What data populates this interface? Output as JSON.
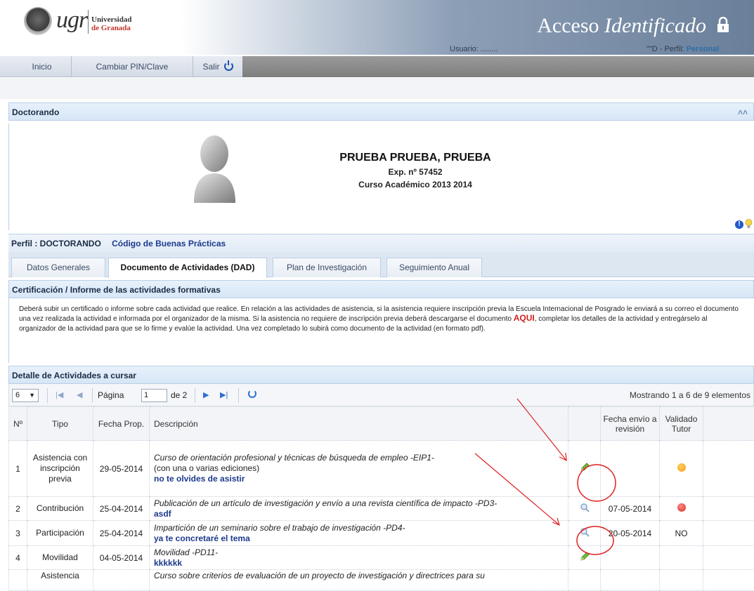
{
  "header": {
    "logo_text": "ugr",
    "university_line1": "Universidad",
    "university_line2": "de Granada",
    "title_plain": "Acceso ",
    "title_italic": "Identificado",
    "user_label": "Usuario: ........",
    "perfil_prefix": "\"\"D - Perfil:",
    "perfil_value": "Personal"
  },
  "nav": {
    "inicio": "Inicio",
    "cambiar_pin": "Cambiar PIN/Clave",
    "salir": "Salir"
  },
  "doctorando": {
    "section_title": "Doctorando",
    "name": "PRUEBA PRUEBA, PRUEBA",
    "expediente": "Exp. nº 57452",
    "curso": "Curso Académico 2013 2014"
  },
  "perfil_bar": {
    "perfil": "Perfil : DOCTORANDO",
    "codigo": "Código de Buenas Prácticas"
  },
  "tabs": [
    {
      "label": "Datos Generales"
    },
    {
      "label": "Documento de Actividades (DAD)"
    },
    {
      "label": "Plan de Investigación"
    },
    {
      "label": "Seguimiento Anual"
    }
  ],
  "certificacion": {
    "title": "Certificación / Informe de las actividades formativas",
    "text_before": "Deberá subir un certificado o informe sobre cada actividad que realice. En relación a las actividades de asistencia, si la asistencia requiere inscripción previa la Escuela Internacional de Posgrado le enviará a su correo el documento una vez realizada la actividad e informada por el organizador de la misma. Si la asistencia no requiere de inscripción previa deberá descargarse el documento ",
    "aqui": "AQUI",
    "text_after": ", completar los detalles de la actividad y entregárselo al organizador de la actividad para que se lo firme y evalúe la actividad. Una vez completado lo subirá como documento de la actividad (en formato pdf)."
  },
  "detalle": {
    "title": "Detalle de Actividades a cursar",
    "page_size": "6",
    "pagina_label": "Página",
    "pagina_value": "1",
    "de_label": "de 2",
    "showing": "Mostrando 1 a 6 de 9 elementos"
  },
  "table": {
    "headers": {
      "num": "Nº",
      "tipo": "Tipo",
      "fecha_prop": "Fecha Prop.",
      "descripcion": "Descripción",
      "accion": "",
      "fecha_envio": "Fecha envío a revisión",
      "validado": "Validado Tutor"
    },
    "rows": [
      {
        "num": "1",
        "tipo": "Asistencia con inscripción previa",
        "fecha": "29-05-2014",
        "titulo": "Curso de orientación profesional y técnicas de búsqueda de empleo -EIP1-",
        "sub": "(con una o varias ediciones)",
        "comentario": "no te olvides de asistir",
        "icon": "pencil-icon",
        "envio": "",
        "validado": "orange"
      },
      {
        "num": "2",
        "tipo": "Contribución",
        "fecha": "25-04-2014",
        "titulo": "Publicación de un artículo de investigación y envío a una revista científica de impacto -PD3-",
        "sub": "",
        "comentario": "asdf",
        "icon": "magnify-icon",
        "envio": "07-05-2014",
        "validado": "red"
      },
      {
        "num": "3",
        "tipo": "Participación",
        "fecha": "25-04-2014",
        "titulo": "Impartición de un seminario sobre el trabajo de investigación -PD4-",
        "sub": "",
        "comentario": "ya te concretaré el tema",
        "icon": "magnify-icon",
        "envio": "20-05-2014",
        "validado": "NO"
      },
      {
        "num": "4",
        "tipo": "Movilidad",
        "fecha": "04-05-2014",
        "titulo": "Movilidad -PD11-",
        "sub": "",
        "comentario": "kkkkkk",
        "icon": "pencil-icon",
        "envio": "",
        "validado": ""
      },
      {
        "num": "",
        "tipo": "Asistencia",
        "fecha": "",
        "titulo": "Curso sobre criterios de evaluación de un proyecto de investigación y directrices para su",
        "sub": "",
        "comentario": "",
        "icon": "",
        "envio": "",
        "validado": ""
      }
    ]
  },
  "colors": {
    "accent": "#2e6fd0",
    "header_gradient_end": "#6a7f9a",
    "annotation_red": "#e02020"
  }
}
